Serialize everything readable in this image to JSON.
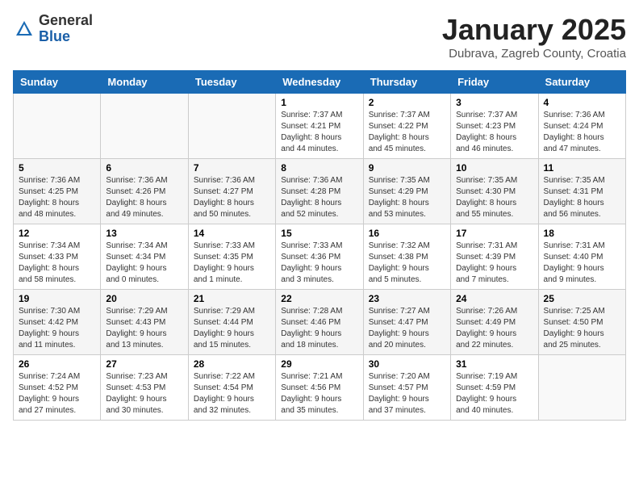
{
  "logo": {
    "general": "General",
    "blue": "Blue"
  },
  "title": "January 2025",
  "location": "Dubrava, Zagreb County, Croatia",
  "weekdays": [
    "Sunday",
    "Monday",
    "Tuesday",
    "Wednesday",
    "Thursday",
    "Friday",
    "Saturday"
  ],
  "weeks": [
    [
      {
        "day": "",
        "info": ""
      },
      {
        "day": "",
        "info": ""
      },
      {
        "day": "",
        "info": ""
      },
      {
        "day": "1",
        "info": "Sunrise: 7:37 AM\nSunset: 4:21 PM\nDaylight: 8 hours\nand 44 minutes."
      },
      {
        "day": "2",
        "info": "Sunrise: 7:37 AM\nSunset: 4:22 PM\nDaylight: 8 hours\nand 45 minutes."
      },
      {
        "day": "3",
        "info": "Sunrise: 7:37 AM\nSunset: 4:23 PM\nDaylight: 8 hours\nand 46 minutes."
      },
      {
        "day": "4",
        "info": "Sunrise: 7:36 AM\nSunset: 4:24 PM\nDaylight: 8 hours\nand 47 minutes."
      }
    ],
    [
      {
        "day": "5",
        "info": "Sunrise: 7:36 AM\nSunset: 4:25 PM\nDaylight: 8 hours\nand 48 minutes."
      },
      {
        "day": "6",
        "info": "Sunrise: 7:36 AM\nSunset: 4:26 PM\nDaylight: 8 hours\nand 49 minutes."
      },
      {
        "day": "7",
        "info": "Sunrise: 7:36 AM\nSunset: 4:27 PM\nDaylight: 8 hours\nand 50 minutes."
      },
      {
        "day": "8",
        "info": "Sunrise: 7:36 AM\nSunset: 4:28 PM\nDaylight: 8 hours\nand 52 minutes."
      },
      {
        "day": "9",
        "info": "Sunrise: 7:35 AM\nSunset: 4:29 PM\nDaylight: 8 hours\nand 53 minutes."
      },
      {
        "day": "10",
        "info": "Sunrise: 7:35 AM\nSunset: 4:30 PM\nDaylight: 8 hours\nand 55 minutes."
      },
      {
        "day": "11",
        "info": "Sunrise: 7:35 AM\nSunset: 4:31 PM\nDaylight: 8 hours\nand 56 minutes."
      }
    ],
    [
      {
        "day": "12",
        "info": "Sunrise: 7:34 AM\nSunset: 4:33 PM\nDaylight: 8 hours\nand 58 minutes."
      },
      {
        "day": "13",
        "info": "Sunrise: 7:34 AM\nSunset: 4:34 PM\nDaylight: 9 hours\nand 0 minutes."
      },
      {
        "day": "14",
        "info": "Sunrise: 7:33 AM\nSunset: 4:35 PM\nDaylight: 9 hours\nand 1 minute."
      },
      {
        "day": "15",
        "info": "Sunrise: 7:33 AM\nSunset: 4:36 PM\nDaylight: 9 hours\nand 3 minutes."
      },
      {
        "day": "16",
        "info": "Sunrise: 7:32 AM\nSunset: 4:38 PM\nDaylight: 9 hours\nand 5 minutes."
      },
      {
        "day": "17",
        "info": "Sunrise: 7:31 AM\nSunset: 4:39 PM\nDaylight: 9 hours\nand 7 minutes."
      },
      {
        "day": "18",
        "info": "Sunrise: 7:31 AM\nSunset: 4:40 PM\nDaylight: 9 hours\nand 9 minutes."
      }
    ],
    [
      {
        "day": "19",
        "info": "Sunrise: 7:30 AM\nSunset: 4:42 PM\nDaylight: 9 hours\nand 11 minutes."
      },
      {
        "day": "20",
        "info": "Sunrise: 7:29 AM\nSunset: 4:43 PM\nDaylight: 9 hours\nand 13 minutes."
      },
      {
        "day": "21",
        "info": "Sunrise: 7:29 AM\nSunset: 4:44 PM\nDaylight: 9 hours\nand 15 minutes."
      },
      {
        "day": "22",
        "info": "Sunrise: 7:28 AM\nSunset: 4:46 PM\nDaylight: 9 hours\nand 18 minutes."
      },
      {
        "day": "23",
        "info": "Sunrise: 7:27 AM\nSunset: 4:47 PM\nDaylight: 9 hours\nand 20 minutes."
      },
      {
        "day": "24",
        "info": "Sunrise: 7:26 AM\nSunset: 4:49 PM\nDaylight: 9 hours\nand 22 minutes."
      },
      {
        "day": "25",
        "info": "Sunrise: 7:25 AM\nSunset: 4:50 PM\nDaylight: 9 hours\nand 25 minutes."
      }
    ],
    [
      {
        "day": "26",
        "info": "Sunrise: 7:24 AM\nSunset: 4:52 PM\nDaylight: 9 hours\nand 27 minutes."
      },
      {
        "day": "27",
        "info": "Sunrise: 7:23 AM\nSunset: 4:53 PM\nDaylight: 9 hours\nand 30 minutes."
      },
      {
        "day": "28",
        "info": "Sunrise: 7:22 AM\nSunset: 4:54 PM\nDaylight: 9 hours\nand 32 minutes."
      },
      {
        "day": "29",
        "info": "Sunrise: 7:21 AM\nSunset: 4:56 PM\nDaylight: 9 hours\nand 35 minutes."
      },
      {
        "day": "30",
        "info": "Sunrise: 7:20 AM\nSunset: 4:57 PM\nDaylight: 9 hours\nand 37 minutes."
      },
      {
        "day": "31",
        "info": "Sunrise: 7:19 AM\nSunset: 4:59 PM\nDaylight: 9 hours\nand 40 minutes."
      },
      {
        "day": "",
        "info": ""
      }
    ]
  ]
}
